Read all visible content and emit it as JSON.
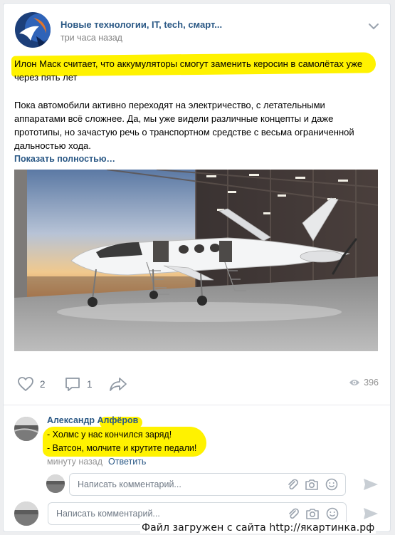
{
  "post": {
    "author": "Новые технологии, IT, tech, смарт...",
    "time": "три часа назад",
    "headline": "Илон Маск считает, что аккумуляторы смогут заменить керосин в самолётах уже через пять лет",
    "body": "Пока автомобили активно переходят на электричество, с летательными аппаратами всё сложнее. Да, мы уже видели различные концепты и даже прототипы, но зачастую речь о транспортном средстве с весьма ограниченной дальностью хода.",
    "show_more": "Показать полностью…",
    "likes": "2",
    "comments": "1",
    "views": "396"
  },
  "comment": {
    "author": "Александр Алфёров",
    "line1": "- Холмс у нас кончился заряд!",
    "line2": "- Ватсон, молчите и крутите педали!",
    "time": "минуту назад",
    "reply": "Ответить"
  },
  "reply_inputs": [
    {
      "placeholder": "Написать комментарий..."
    },
    {
      "placeholder": "Написать комментарий..."
    }
  ],
  "watermark": "Файл загружен с сайта http://якартинка.рф",
  "colors": {
    "link": "#2a5885",
    "highlight": "#fff200",
    "muted": "#828282",
    "icon": "#99a2ad"
  }
}
